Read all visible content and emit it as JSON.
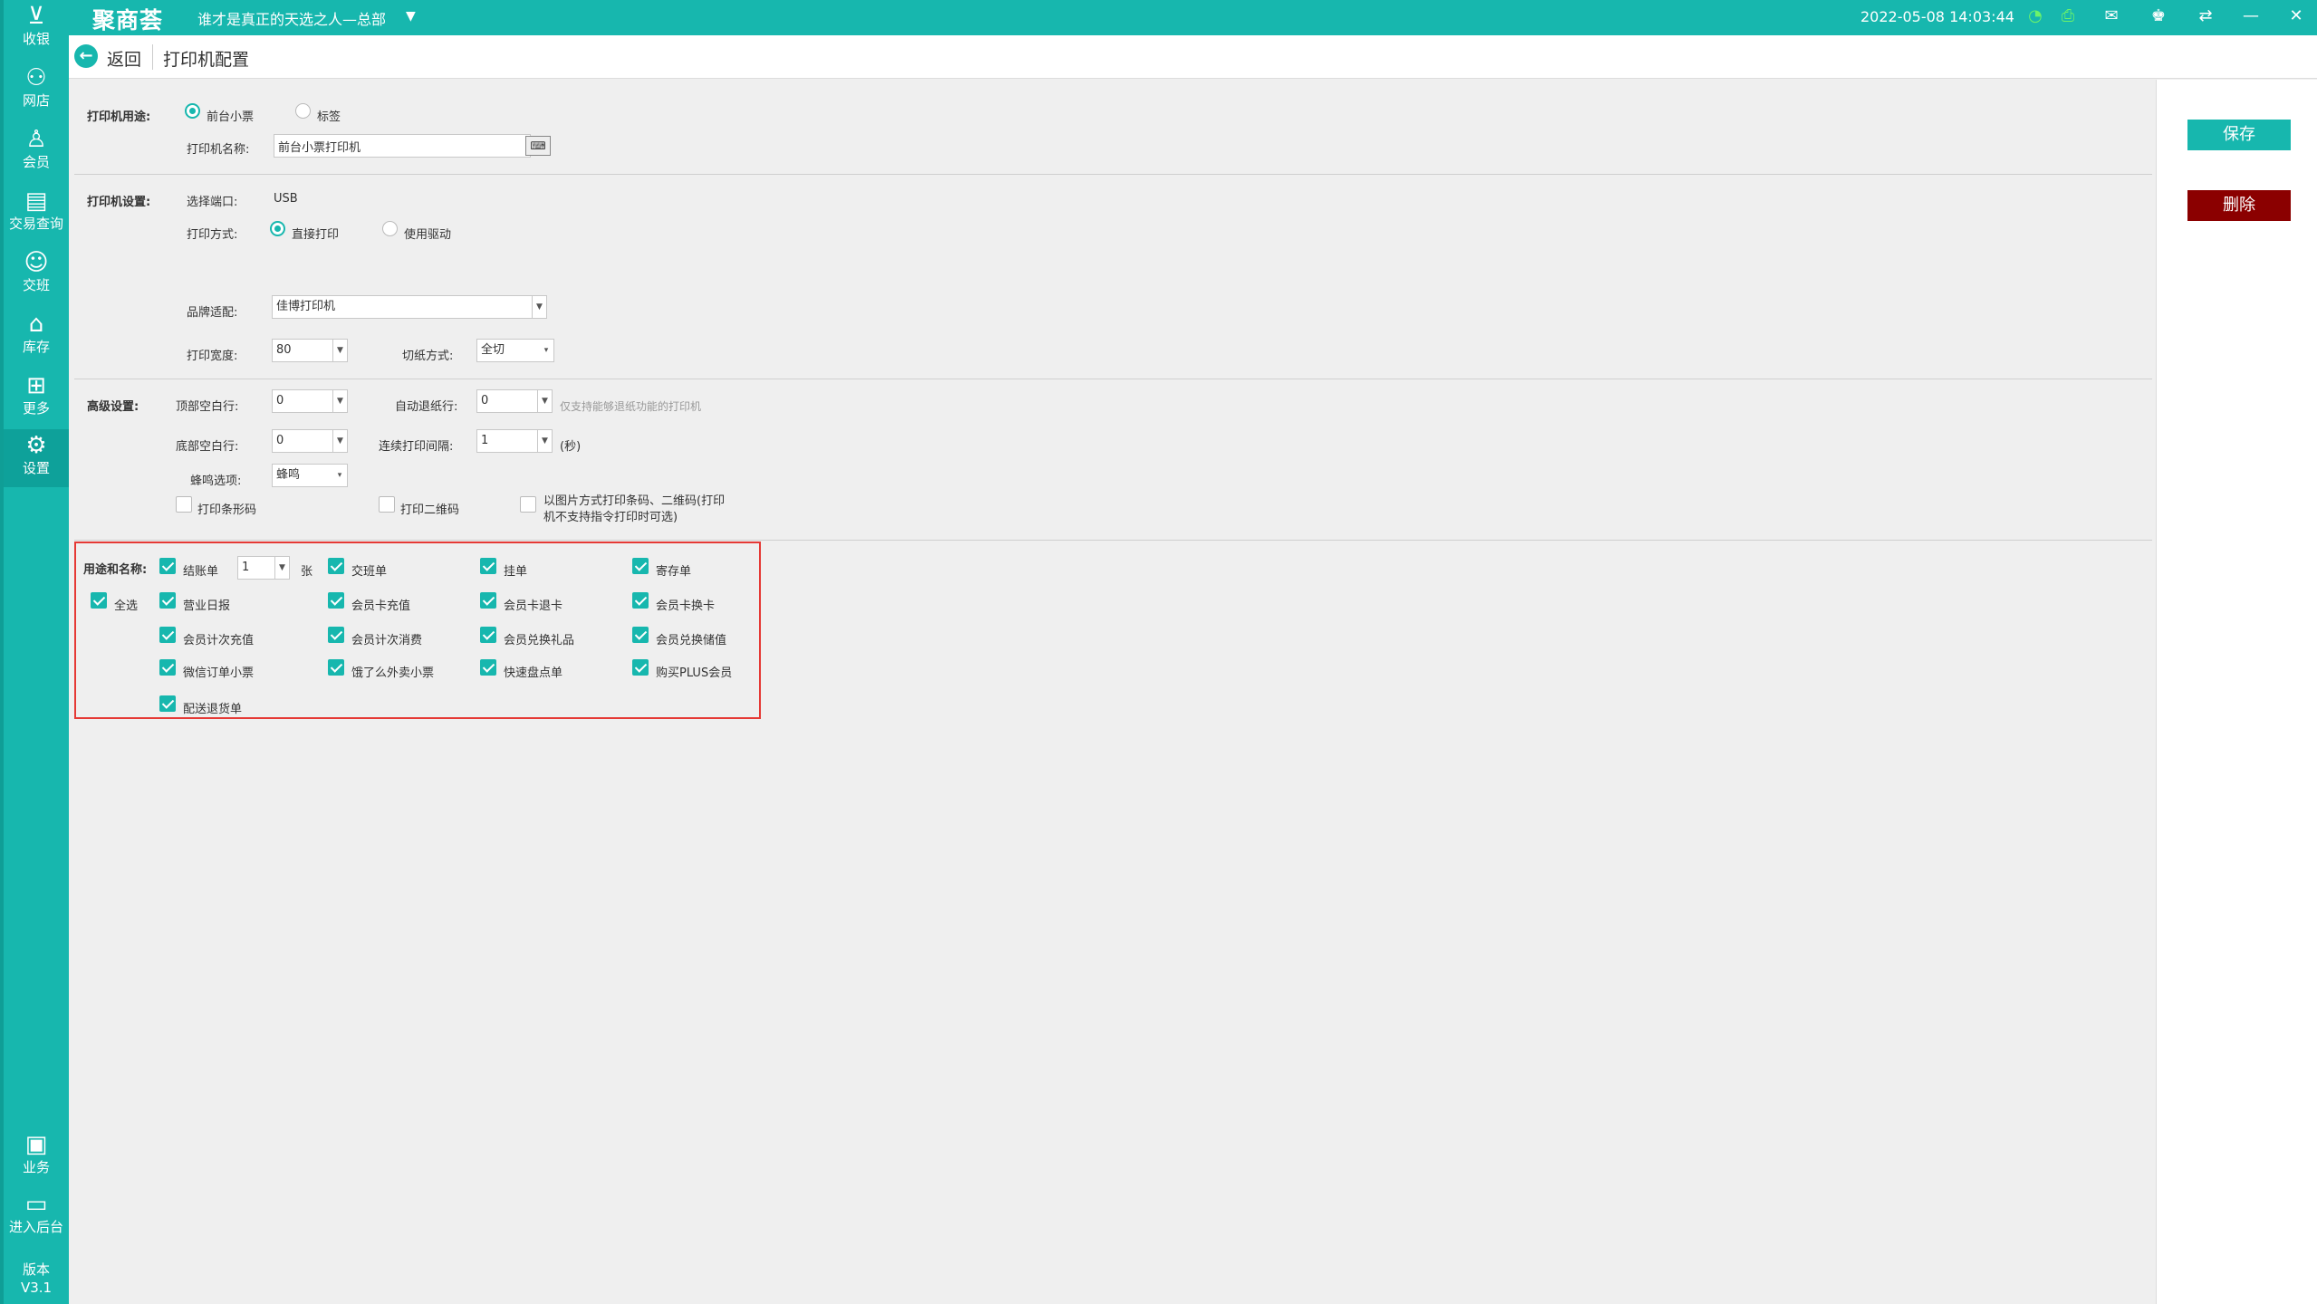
{
  "topbar": {
    "logo": "聚商荟",
    "store": "谁才是真正的天选之人—总部",
    "datetime": "2022-05-08 14:03:44",
    "icons": [
      "wifi-icon",
      "printer-icon",
      "message-icon",
      "shirt-icon",
      "swap-icon",
      "minimize-icon",
      "close-icon"
    ]
  },
  "sidebar": {
    "items": [
      {
        "label": "收银",
        "icon": "cashier-icon"
      },
      {
        "label": "网店",
        "icon": "bike-icon"
      },
      {
        "label": "会员",
        "icon": "member-icon"
      },
      {
        "label": "交易查询",
        "icon": "document-icon"
      },
      {
        "label": "交班",
        "icon": "handover-icon"
      },
      {
        "label": "库存",
        "icon": "warehouse-icon"
      },
      {
        "label": "更多",
        "icon": "grid-icon"
      },
      {
        "label": "设置",
        "icon": "gear-icon"
      },
      {
        "label": "业务",
        "icon": "business-icon"
      },
      {
        "label": "进入后台",
        "icon": "monitor-icon"
      }
    ],
    "active": "设置",
    "version_label": "版本",
    "version": "V3.1"
  },
  "subheader": {
    "back_label": "返回",
    "title": "打印机配置"
  },
  "actions": {
    "save": "保存",
    "delete": "删除"
  },
  "printer_usage": {
    "label": "打印机用途:",
    "options": [
      "前台小票",
      "标签"
    ],
    "selected": "前台小票",
    "name_label": "打印机名称:",
    "name_value": "前台小票打印机"
  },
  "printer_settings": {
    "label": "打印机设置:",
    "port_label": "选择端口:",
    "port_value": "USB",
    "method_label": "打印方式:",
    "method_options": [
      "直接打印",
      "使用驱动"
    ],
    "method_selected": "直接打印",
    "brand_label": "品牌适配:",
    "brand_value": "佳博打印机",
    "width_label": "打印宽度:",
    "width_value": "80",
    "cut_label": "切纸方式:",
    "cut_value": "全切"
  },
  "advanced": {
    "label": "高级设置:",
    "top_blank_label": "顶部空白行:",
    "top_blank_value": "0",
    "auto_feed_label": "自动退纸行:",
    "auto_feed_value": "0",
    "auto_feed_note": "仅支持能够退纸功能的打印机",
    "bottom_blank_label": "底部空白行:",
    "bottom_blank_value": "0",
    "interval_label": "连续打印间隔:",
    "interval_value": "1",
    "interval_unit": "(秒)",
    "buzzer_label": "蜂鸣选项:",
    "buzzer_value": "蜂鸣",
    "print_barcode": "打印条形码",
    "print_qrcode": "打印二维码",
    "image_mode_line1": "以图片方式打印条码、二维码(打印",
    "image_mode_line2": "机不支持指令打印时可选)"
  },
  "usage_names": {
    "label": "用途和名称:",
    "select_all": "全选",
    "copies_value": "1",
    "copies_unit": "张",
    "items": [
      "结账单",
      "交班单",
      "挂单",
      "寄存单",
      "营业日报",
      "会员卡充值",
      "会员卡退卡",
      "会员卡换卡",
      "会员计次充值",
      "会员计次消费",
      "会员兑换礼品",
      "会员兑换储值",
      "微信订单小票",
      "饿了么外卖小票",
      "快速盘点单",
      "购买PLUS会员",
      "配送退货单"
    ]
  }
}
